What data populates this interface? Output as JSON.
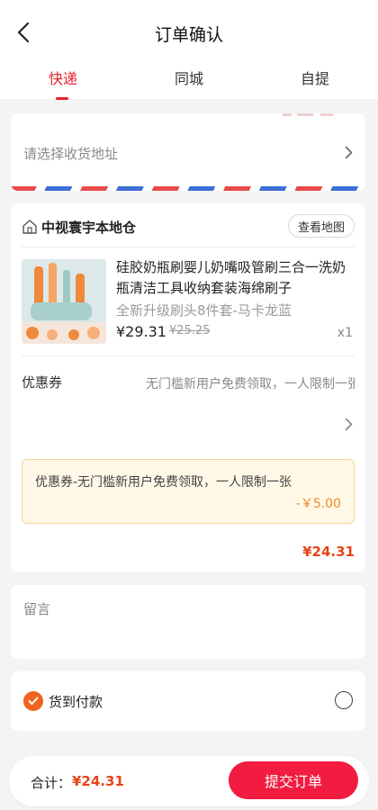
{
  "header": {
    "title": "订单确认",
    "tabs": [
      {
        "label": "快递",
        "active": true
      },
      {
        "label": "同城",
        "active": false
      },
      {
        "label": "自提",
        "active": false
      }
    ]
  },
  "address": {
    "placeholder": "请选择收货地址"
  },
  "store": {
    "name": "中视寰宇本地仓",
    "map_button": "查看地图",
    "icon": "home-icon"
  },
  "product": {
    "title": "硅胶奶瓶刷婴儿奶嘴吸管刷三合一洗奶瓶清洁工具收纳套装海绵刷子",
    "spec": "全新升级刷头8件套-马卡龙蓝",
    "price": "¥29.31",
    "original_price": "¥25.25",
    "quantity": "x1"
  },
  "coupon": {
    "label": "优惠券",
    "description": "无门槛新用户免费领取，一人限制一张",
    "applied_text": "优惠券-无门槛新用户免费领取，一人限制一张",
    "applied_amount": "-￥5.00"
  },
  "order_total": "¥24.31",
  "note": {
    "label": "留言"
  },
  "payment": {
    "label": "货到付款",
    "selected": true
  },
  "bottom": {
    "total_label": "合计：",
    "total_value": "¥24.31",
    "submit_label": "提交订单"
  },
  "colors": {
    "accent": "#e8202f",
    "price": "#e84316",
    "submit": "#f21c40",
    "check": "#f0641e"
  }
}
